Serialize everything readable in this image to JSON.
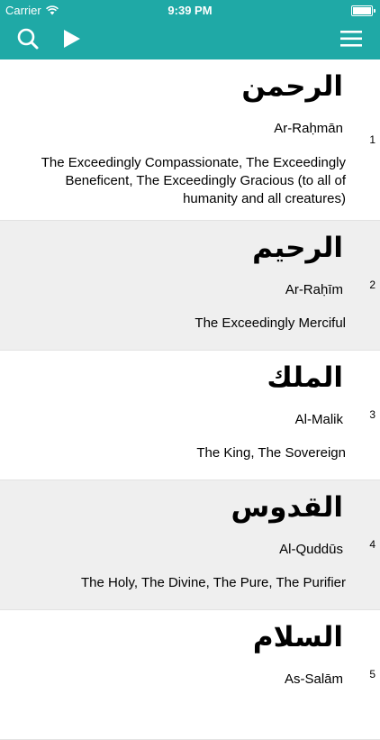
{
  "status_bar": {
    "carrier": "Carrier",
    "time": "9:39 PM"
  },
  "nav": {
    "search_icon": "search-icon",
    "play_icon": "play-icon",
    "menu_icon": "hamburger-menu-icon",
    "color": "#1fa9a6"
  },
  "names": [
    {
      "number": "1",
      "arabic": "الرحمن",
      "transliteration": "Ar-Raḥmān",
      "meaning": "The Exceedingly Compassionate, The Exceedingly Beneficent, The Exceedingly Gracious (to all of humanity and all creatures)"
    },
    {
      "number": "2",
      "arabic": "الرحيم",
      "transliteration": "Ar-Raḥīm",
      "meaning": "The Exceedingly Merciful"
    },
    {
      "number": "3",
      "arabic": "الملك",
      "transliteration": "Al-Malik",
      "meaning": "The King, The Sovereign"
    },
    {
      "number": "4",
      "arabic": "القدوس",
      "transliteration": "Al-Quddūs",
      "meaning": "The Holy, The Divine, The Pure, The Purifier"
    },
    {
      "number": "5",
      "arabic": "السلام",
      "transliteration": "As-Salām",
      "meaning": ""
    }
  ]
}
